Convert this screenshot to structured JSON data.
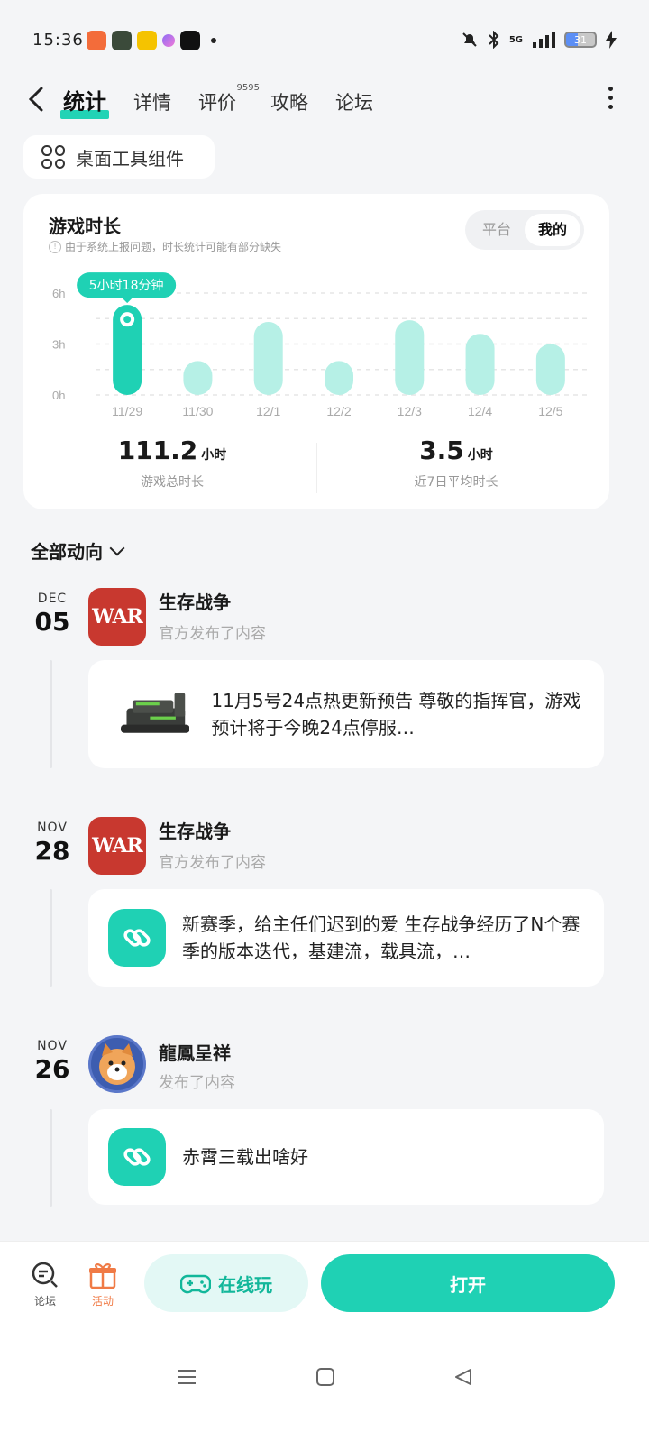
{
  "status_bar": {
    "time": "15:36",
    "signal_label": "5G",
    "battery": "31"
  },
  "nav": {
    "tabs": [
      {
        "label": "统计",
        "active": true
      },
      {
        "label": "详情",
        "active": false
      },
      {
        "label": "评价",
        "badge": "9595",
        "active": false
      },
      {
        "label": "攻略",
        "active": false
      },
      {
        "label": "论坛",
        "active": false
      }
    ]
  },
  "widget_button": {
    "label": "桌面工具组件"
  },
  "playtime_card": {
    "title": "游戏时长",
    "notice": "由于系统上报问题，时长统计可能有部分缺失",
    "segments": [
      {
        "label": "平台",
        "active": false
      },
      {
        "label": "我的",
        "active": true
      }
    ],
    "tooltip": "5小时18分钟",
    "stats": [
      {
        "value": "111.2",
        "unit": "小时",
        "label": "游戏总时长"
      },
      {
        "value": "3.5",
        "unit": "小时",
        "label": "近7日平均时长"
      }
    ]
  },
  "chart_data": {
    "type": "bar",
    "categories": [
      "11/29",
      "11/30",
      "12/1",
      "12/2",
      "12/3",
      "12/4",
      "12/5"
    ],
    "values": [
      5.3,
      2.0,
      4.3,
      2.0,
      4.4,
      3.6,
      3.0
    ],
    "highlighted_index": 0,
    "y_ticks": [
      "0h",
      "3h",
      "6h"
    ],
    "ylim": [
      0,
      6
    ],
    "grid": true,
    "colors": {
      "highlight": "#1fd1b4",
      "normal": "#b6f0e6"
    }
  },
  "feed": {
    "header": "全部动向",
    "items": [
      {
        "month": "DEC",
        "day": "05",
        "author": "生存战争",
        "action": "官方发布了内容",
        "avatar_text": "WAR",
        "post_text": "11月5号24点热更新预告 尊敬的指挥官，游戏预计将于今晚24点停服…",
        "post_kind": "image"
      },
      {
        "month": "NOV",
        "day": "28",
        "author": "生存战争",
        "action": "官方发布了内容",
        "avatar_text": "WAR",
        "post_text": "新赛季，给主任们迟到的爱 生存战争经历了N个赛季的版本迭代，基建流，载具流，…",
        "post_kind": "link"
      },
      {
        "month": "NOV",
        "day": "26",
        "author": "龍鳳呈祥",
        "action": "发布了内容",
        "avatar_text": "",
        "post_text": "赤霄三载出啥好",
        "post_kind": "link"
      }
    ]
  },
  "bottom_bar": {
    "forum_label": "论坛",
    "activity_label": "活动",
    "cloud_play_label": "在线玩",
    "open_label": "打开",
    "colors": {
      "accent": "#1fd1b4",
      "activity": "#f07a45"
    }
  }
}
